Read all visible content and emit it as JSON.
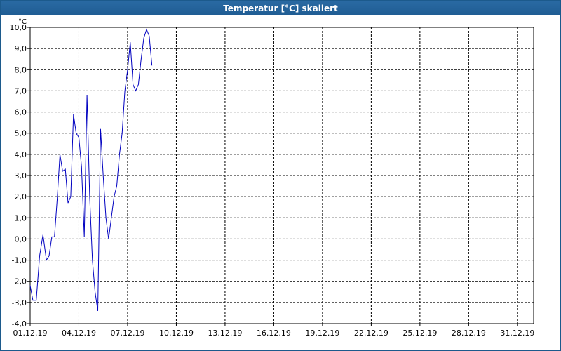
{
  "window": {
    "title": "Temperatur [°C] skaliert"
  },
  "colors": {
    "line": "#0000c0",
    "grid": "#000000",
    "titlebar": "#1f5c93"
  },
  "chart_data": {
    "type": "line",
    "title": "Temperatur [°C] skaliert",
    "ylabel": "°C",
    "xlabel": "",
    "ylim": [
      -4.0,
      10.0
    ],
    "xlim": [
      "2019-12-01",
      "2020-01-01"
    ],
    "y_ticks": [
      -4.0,
      -3.0,
      -2.0,
      -1.0,
      0.0,
      1.0,
      2.0,
      3.0,
      4.0,
      5.0,
      6.0,
      7.0,
      8.0,
      9.0,
      10.0
    ],
    "y_tick_labels": [
      "-4,0",
      "-3,0",
      "-2,0",
      "-1,0",
      "0,0",
      "1,0",
      "2,0",
      "3,0",
      "4,0",
      "5,0",
      "6,0",
      "7,0",
      "8,0",
      "9,0",
      "10,0"
    ],
    "x_ticks": [
      "2019-12-01",
      "2019-12-04",
      "2019-12-07",
      "2019-12-10",
      "2019-12-13",
      "2019-12-16",
      "2019-12-19",
      "2019-12-22",
      "2019-12-25",
      "2019-12-28",
      "2019-12-31"
    ],
    "x_tick_labels": [
      "01.12.19",
      "04.12.19",
      "07.12.19",
      "10.12.19",
      "13.12.19",
      "16.12.19",
      "19.12.19",
      "22.12.19",
      "25.12.19",
      "28.12.19",
      "31.12.19"
    ],
    "grid": true,
    "series": [
      {
        "x": [
          "2019-12-01 00:00",
          "2019-12-01 04:00",
          "2019-12-01 09:00",
          "2019-12-01 14:00",
          "2019-12-01 19:00",
          "2019-12-02 00:00",
          "2019-12-02 04:00",
          "2019-12-02 08:00",
          "2019-12-02 12:00",
          "2019-12-02 16:00",
          "2019-12-02 20:00",
          "2019-12-03 00:00",
          "2019-12-03 04:00",
          "2019-12-03 08:00",
          "2019-12-03 12:00",
          "2019-12-03 16:00",
          "2019-12-03 20:00",
          "2019-12-04 00:00",
          "2019-12-04 04:00",
          "2019-12-04 08:00",
          "2019-12-04 12:00",
          "2019-12-04 16:00",
          "2019-12-04 20:00",
          "2019-12-05 00:00",
          "2019-12-05 04:00",
          "2019-12-05 08:00",
          "2019-12-05 12:00",
          "2019-12-05 16:00",
          "2019-12-05 20:00",
          "2019-12-06 00:00",
          "2019-12-06 04:00",
          "2019-12-06 08:00",
          "2019-12-06 12:00",
          "2019-12-06 16:00",
          "2019-12-06 20:00",
          "2019-12-07 00:00",
          "2019-12-07 04:00",
          "2019-12-07 08:00",
          "2019-12-07 12:00",
          "2019-12-07 16:00",
          "2019-12-07 20:00",
          "2019-12-08 00:00",
          "2019-12-08 04:00",
          "2019-12-08 08:00",
          "2019-12-08 12:00",
          "2019-12-08 16:00",
          "2019-12-08 20:00",
          "2019-12-09 00:00",
          "2019-12-09 04:00",
          "2019-12-09 08:00",
          "2019-12-09 12:00",
          "2019-12-09 16:00"
        ],
        "values": [
          -2.2,
          -2.9,
          -2.9,
          -0.8,
          0.2,
          -1.0,
          -0.8,
          0.1,
          0.1,
          1.9,
          4.0,
          3.2,
          3.3,
          1.7,
          2.0,
          5.9,
          5.0,
          4.8,
          3.4,
          0.1,
          6.8,
          2.0,
          -1.0,
          -2.5,
          -3.4,
          5.2,
          3.0,
          1.0,
          0.0,
          1.0,
          2.0,
          2.5,
          4.0,
          5.0,
          7.0,
          8.0,
          9.3,
          7.3,
          7.0,
          7.3,
          8.5,
          9.5,
          9.9,
          9.6,
          8.2,
          null,
          null,
          null,
          null,
          null,
          null,
          null
        ]
      }
    ]
  }
}
